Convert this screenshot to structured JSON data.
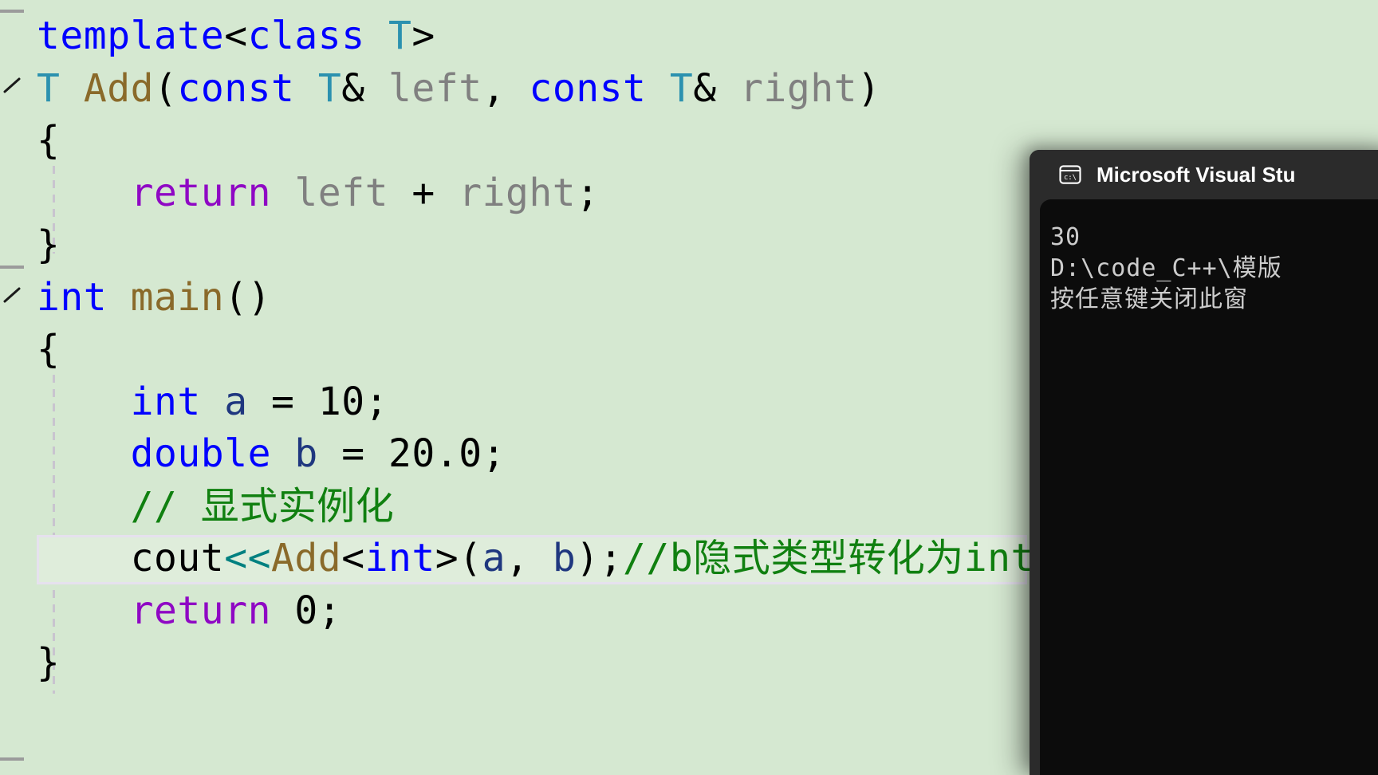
{
  "editor": {
    "background_color": "#d5e8d1",
    "current_line_border_color": "#e6e1ee",
    "lines": [
      {
        "id": "line-template",
        "tokens": [
          {
            "text": "template",
            "cls": "t-kw"
          },
          {
            "text": "<",
            "cls": "t-plain"
          },
          {
            "text": "class",
            "cls": "t-kw"
          },
          {
            "text": " ",
            "cls": "t-plain"
          },
          {
            "text": "T",
            "cls": "t-type"
          },
          {
            "text": ">",
            "cls": "t-plain"
          }
        ]
      },
      {
        "id": "line-add-signature",
        "tokens": [
          {
            "text": "T",
            "cls": "t-type"
          },
          {
            "text": " ",
            "cls": "t-plain"
          },
          {
            "text": "Add",
            "cls": "t-fn"
          },
          {
            "text": "(",
            "cls": "t-plain"
          },
          {
            "text": "const",
            "cls": "t-kw"
          },
          {
            "text": " ",
            "cls": "t-plain"
          },
          {
            "text": "T",
            "cls": "t-type"
          },
          {
            "text": "& ",
            "cls": "t-plain"
          },
          {
            "text": "left",
            "cls": "t-id"
          },
          {
            "text": ", ",
            "cls": "t-plain"
          },
          {
            "text": "const",
            "cls": "t-kw"
          },
          {
            "text": " ",
            "cls": "t-plain"
          },
          {
            "text": "T",
            "cls": "t-type"
          },
          {
            "text": "& ",
            "cls": "t-plain"
          },
          {
            "text": "right",
            "cls": "t-id"
          },
          {
            "text": ")",
            "cls": "t-plain"
          }
        ]
      },
      {
        "id": "line-add-open-brace",
        "tokens": [
          {
            "text": "{",
            "cls": "t-plain"
          }
        ]
      },
      {
        "id": "line-return-left-right",
        "tokens": [
          {
            "text": "    ",
            "cls": "t-plain"
          },
          {
            "text": "return",
            "cls": "t-ret"
          },
          {
            "text": " ",
            "cls": "t-plain"
          },
          {
            "text": "left",
            "cls": "t-id"
          },
          {
            "text": " + ",
            "cls": "t-plain"
          },
          {
            "text": "right",
            "cls": "t-id"
          },
          {
            "text": ";",
            "cls": "t-plain"
          }
        ]
      },
      {
        "id": "line-add-close-brace",
        "tokens": [
          {
            "text": "}",
            "cls": "t-plain"
          }
        ]
      },
      {
        "id": "line-int-main",
        "tokens": [
          {
            "text": "int",
            "cls": "t-kw"
          },
          {
            "text": " ",
            "cls": "t-plain"
          },
          {
            "text": "main",
            "cls": "t-fn"
          },
          {
            "text": "()",
            "cls": "t-plain"
          }
        ]
      },
      {
        "id": "line-main-open-brace",
        "tokens": [
          {
            "text": "{",
            "cls": "t-plain"
          }
        ]
      },
      {
        "id": "line-decl-a",
        "tokens": [
          {
            "text": "    ",
            "cls": "t-plain"
          },
          {
            "text": "int",
            "cls": "t-kw"
          },
          {
            "text": " ",
            "cls": "t-plain"
          },
          {
            "text": "a",
            "cls": "t-var"
          },
          {
            "text": " = ",
            "cls": "t-plain"
          },
          {
            "text": "10",
            "cls": "t-num"
          },
          {
            "text": ";",
            "cls": "t-plain"
          }
        ]
      },
      {
        "id": "line-decl-b",
        "tokens": [
          {
            "text": "    ",
            "cls": "t-plain"
          },
          {
            "text": "double",
            "cls": "t-kw"
          },
          {
            "text": " ",
            "cls": "t-plain"
          },
          {
            "text": "b",
            "cls": "t-var"
          },
          {
            "text": " = ",
            "cls": "t-plain"
          },
          {
            "text": "20.0",
            "cls": "t-num"
          },
          {
            "text": ";",
            "cls": "t-plain"
          }
        ]
      },
      {
        "id": "line-comment-explicit-instantiation",
        "tokens": [
          {
            "text": "    ",
            "cls": "t-plain"
          },
          {
            "text": "// ",
            "cls": "t-cmt"
          },
          {
            "text": "显式实例化",
            "cls": "t-cmt cjk"
          }
        ]
      },
      {
        "id": "line-cout-add",
        "current": true,
        "tokens": [
          {
            "text": "    ",
            "cls": "t-plain"
          },
          {
            "text": "cout",
            "cls": "t-plain"
          },
          {
            "text": "<<",
            "cls": "t-op"
          },
          {
            "text": "Add",
            "cls": "t-fn"
          },
          {
            "text": "<",
            "cls": "t-plain"
          },
          {
            "text": "int",
            "cls": "t-kw"
          },
          {
            "text": ">",
            "cls": "t-plain"
          },
          {
            "text": "(",
            "cls": "t-plain"
          },
          {
            "text": "a",
            "cls": "t-var"
          },
          {
            "text": ", ",
            "cls": "t-plain"
          },
          {
            "text": "b",
            "cls": "t-var"
          },
          {
            "text": ");",
            "cls": "t-plain"
          },
          {
            "text": "//b",
            "cls": "t-cmt"
          },
          {
            "text": "隐式类型转化为",
            "cls": "t-cmt cjk"
          },
          {
            "text": "int",
            "cls": "t-cmt"
          },
          {
            "text": "。",
            "cls": "t-cmt cjk"
          }
        ]
      },
      {
        "id": "line-return-zero",
        "tokens": [
          {
            "text": "    ",
            "cls": "t-plain"
          },
          {
            "text": "return",
            "cls": "t-ret"
          },
          {
            "text": " ",
            "cls": "t-plain"
          },
          {
            "text": "0",
            "cls": "t-num"
          },
          {
            "text": ";",
            "cls": "t-plain"
          }
        ]
      },
      {
        "id": "line-main-close-brace",
        "tokens": [
          {
            "text": "}",
            "cls": "t-plain"
          }
        ]
      }
    ],
    "gutter": {
      "collapse_markers": [
        "collapse-chevron-template",
        "collapse-chevron-main"
      ],
      "separators": 3
    }
  },
  "console": {
    "icon": "command-prompt-icon",
    "title": "Microsoft Visual Stu",
    "background_color": "#0c0c0c",
    "titlebar_color": "#2b2b2b",
    "lines": [
      "30",
      "D:\\code_C++\\模版",
      "按任意键关闭此窗"
    ]
  }
}
